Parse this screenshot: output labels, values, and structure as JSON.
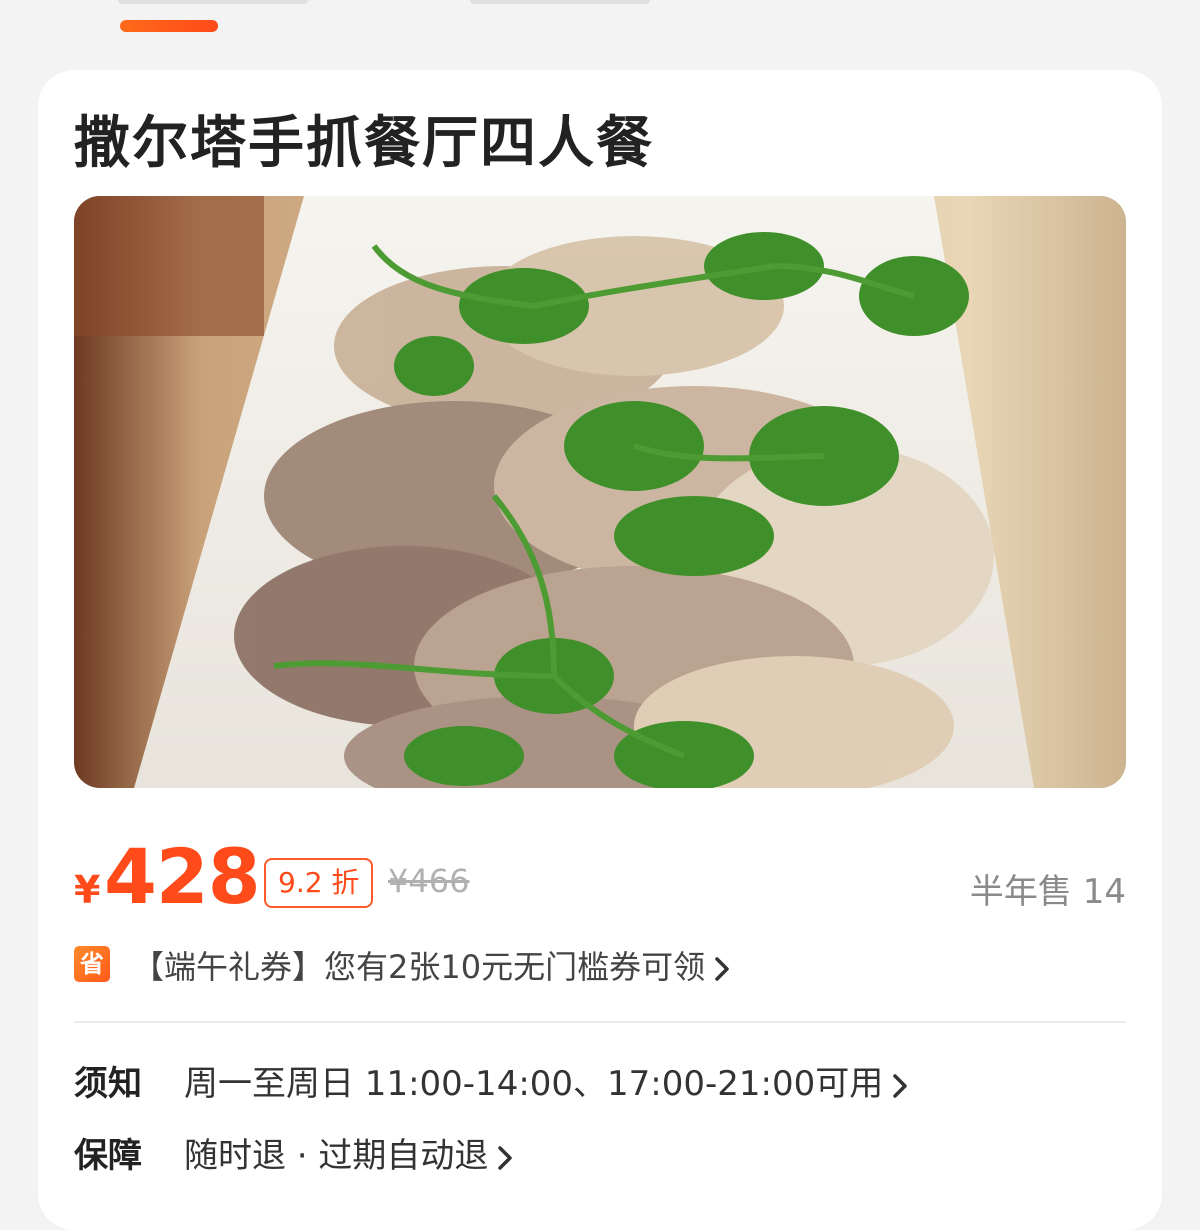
{
  "product": {
    "title": "撒尔塔手抓餐厅四人餐",
    "image_alt": "手抓羊肉配香菜"
  },
  "pricing": {
    "currency": "¥",
    "price": "428",
    "discount": "9.2 折",
    "original_price": "¥466",
    "sales": "半年售 14"
  },
  "coupon": {
    "icon_char": "省",
    "text": "【端午礼券】您有2张10元无门槛券可领"
  },
  "notice": {
    "label": "须知",
    "text": "周一至周日 11:00-14:00、17:00-21:00可用"
  },
  "guarantee": {
    "label": "保障",
    "text": "随时退 · 过期自动退"
  },
  "colors": {
    "accent": "#ff4a1a",
    "card_bg": "#ffffff",
    "page_bg": "#f3f3f3"
  }
}
